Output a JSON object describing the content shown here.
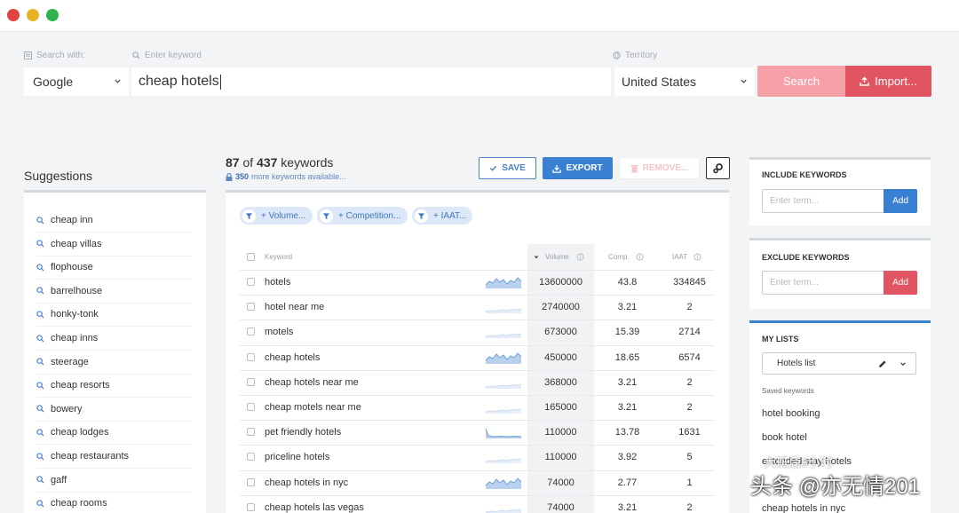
{
  "search": {
    "search_with_label": "Search with:",
    "keyword_label": "Enter keyword",
    "territory_label": "Territory",
    "engine": "Google",
    "keyword": "cheap hotels",
    "territory": "United States",
    "search_button": "Search",
    "import_button": "Import..."
  },
  "suggestions": {
    "title": "Suggestions",
    "items": [
      "cheap inn",
      "cheap villas",
      "flophouse",
      "barrelhouse",
      "honky-tonk",
      "cheap inns",
      "steerage",
      "cheap resorts",
      "bowery",
      "cheap lodges",
      "cheap restaurants",
      "gaff",
      "cheap rooms"
    ]
  },
  "results": {
    "shown": "87",
    "of_text": "of",
    "total": "437",
    "keywords_text": "keywords",
    "more_count": "350",
    "more_text": "more keywords available...",
    "save_button": "SAVE",
    "export_button": "EXPORT",
    "remove_button": "REMOVE...",
    "filters": [
      "+ Volume...",
      "+ Competition...",
      "+ IAAT..."
    ],
    "columns": {
      "keyword": "Keyword",
      "volume": "Volume",
      "comp": "Comp.",
      "iaat": "IAAT"
    },
    "rows": [
      {
        "keyword": "hotels",
        "volume": "13600000",
        "comp": "43.8",
        "iaat": "334845",
        "trend": "strong"
      },
      {
        "keyword": "hotel near me",
        "volume": "2740000",
        "comp": "3.21",
        "iaat": "2",
        "trend": "faint"
      },
      {
        "keyword": "motels",
        "volume": "673000",
        "comp": "15.39",
        "iaat": "2714",
        "trend": "faint"
      },
      {
        "keyword": "cheap hotels",
        "volume": "450000",
        "comp": "18.65",
        "iaat": "6574",
        "trend": "strong"
      },
      {
        "keyword": "cheap hotels near me",
        "volume": "368000",
        "comp": "3.21",
        "iaat": "2",
        "trend": "faint"
      },
      {
        "keyword": "cheap motels near me",
        "volume": "165000",
        "comp": "3.21",
        "iaat": "2",
        "trend": "faint"
      },
      {
        "keyword": "pet friendly hotels",
        "volume": "110000",
        "comp": "13.78",
        "iaat": "1631",
        "trend": "strong"
      },
      {
        "keyword": "priceline hotels",
        "volume": "110000",
        "comp": "3.92",
        "iaat": "5",
        "trend": "faint"
      },
      {
        "keyword": "cheap hotels in nyc",
        "volume": "74000",
        "comp": "2.77",
        "iaat": "1",
        "trend": "strong"
      },
      {
        "keyword": "cheap hotels las vegas",
        "volume": "74000",
        "comp": "3.21",
        "iaat": "2",
        "trend": "faint"
      }
    ]
  },
  "include": {
    "title": "INCLUDE KEYWORDS",
    "placeholder": "Enter term...",
    "add": "Add"
  },
  "exclude": {
    "title": "EXCLUDE KEYWORDS",
    "placeholder": "Enter term...",
    "add": "Add"
  },
  "lists": {
    "title": "MY LISTS",
    "selected": "Hotels list",
    "saved_label": "Saved keywords",
    "items": [
      "hotel booking",
      "book hotel",
      "extended stay hotels",
      "cheap hotels in nyc"
    ]
  },
  "watermark": {
    "main": "头条 @亦无情201",
    "sub": "大班后8小时"
  },
  "colors": {
    "accent_blue": "#3a80d2",
    "accent_red": "#e05561",
    "search_pink": "#f6a0a7"
  }
}
